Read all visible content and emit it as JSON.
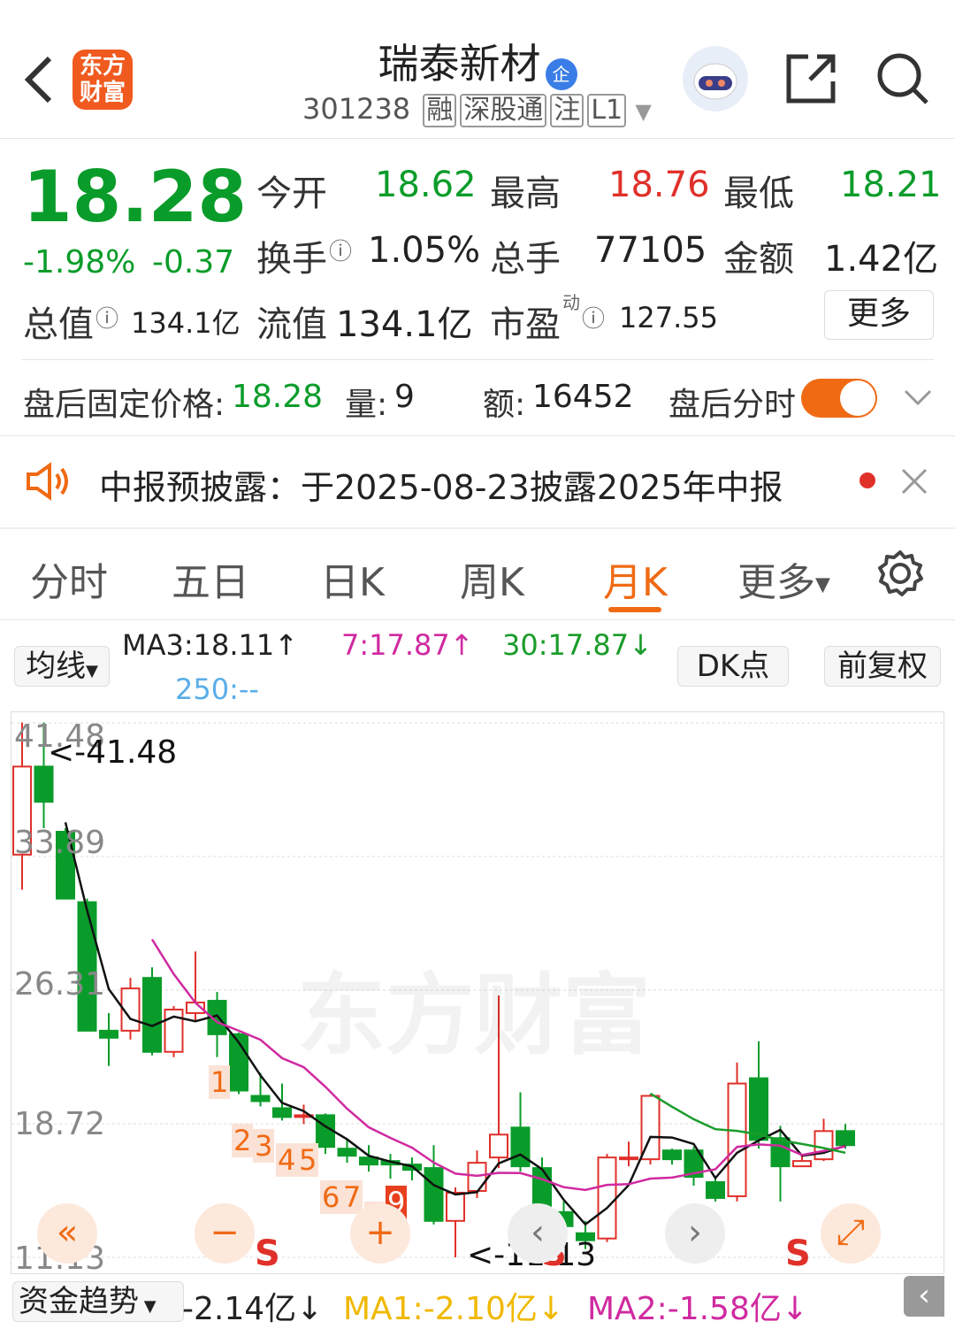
{
  "header": {
    "title": "瑞泰新材",
    "badge": "企",
    "logo_line1": "东方",
    "logo_line2": "财富",
    "code": "301238",
    "tags": [
      "融",
      "深股通",
      "注",
      "L1"
    ]
  },
  "quote": {
    "price": "18.28",
    "change_pct": "-1.98%",
    "change": "-0.37",
    "open_label": "今开",
    "open": "18.62",
    "high_label": "最高",
    "high": "18.76",
    "low_label": "最低",
    "low": "18.21",
    "turnover_label": "换手",
    "turnover": "1.05%",
    "volume_label": "总手",
    "volume": "77105",
    "amount_label": "金额",
    "amount": "1.42亿",
    "mktcap_label": "总值",
    "mktcap": "134.1亿",
    "float_label": "流值",
    "float": "134.1亿",
    "pe_label": "市盈",
    "pe_sup": "动",
    "pe": "127.55",
    "more_label": "更多"
  },
  "after_hours": {
    "price_label": "盘后固定价格:",
    "price": "18.28",
    "vol_label": "量:",
    "vol": "9",
    "amt_label": "额:",
    "amt": "16452",
    "toggle_label": "盘后分时"
  },
  "notice": {
    "text": "中报预披露：于2025-08-23披露2025年中报"
  },
  "tabs": [
    "分时",
    "五日",
    "日K",
    "周K",
    "月K",
    "更多"
  ],
  "active_tab": "月K",
  "ma_bar": {
    "avg_label": "均线",
    "ma3": "MA3:18.11↑",
    "ma7": "7:17.87↑",
    "ma30": "30:17.87↓",
    "ma250": "250:--",
    "dk_label": "DK点",
    "adj_label": "前复权"
  },
  "chart_data": {
    "type": "candlestick",
    "y_ticks": [
      "41.48",
      "33.89",
      "26.31",
      "18.72",
      "11.13"
    ],
    "ylim": [
      11.13,
      41.48
    ],
    "max_label": "<-41.48",
    "min_label": "<-11.13",
    "watermark": "东方财富",
    "signals": [
      "1",
      "2",
      "3",
      "4",
      "5",
      "6",
      "7",
      "8",
      "9",
      "S",
      "S",
      "S"
    ],
    "candles": [
      [
        34,
        39,
        32,
        41.5
      ],
      [
        39,
        37,
        35.5,
        41.5
      ],
      [
        35.3,
        31.5,
        31.5,
        35.5
      ],
      [
        31.3,
        24,
        24,
        31.5
      ],
      [
        24,
        23.6,
        22,
        25
      ],
      [
        24,
        26.4,
        23.5,
        27
      ],
      [
        27,
        22.8,
        22.6,
        27.6
      ],
      [
        22.8,
        25.2,
        22.5,
        25.4
      ],
      [
        25,
        25.6,
        24.5,
        28.5
      ],
      [
        25.7,
        23.8,
        22.5,
        26.2
      ],
      [
        23.8,
        20.6,
        20.4,
        23.9
      ],
      [
        20.3,
        20,
        19.7,
        21.6
      ],
      [
        19.6,
        19.1,
        18.9,
        21
      ],
      [
        19.2,
        19.2,
        18.7,
        19.8
      ],
      [
        19.2,
        17.4,
        17,
        19.3
      ],
      [
        17.3,
        16.9,
        16.5,
        17.8
      ],
      [
        16.8,
        16.4,
        16,
        17.5
      ],
      [
        16.6,
        16.4,
        15.6,
        17
      ],
      [
        16.4,
        16.1,
        15.5,
        16.8
      ],
      [
        16.2,
        13.2,
        13,
        17.5
      ],
      [
        13.2,
        14.8,
        11.13,
        15.1
      ],
      [
        14.9,
        16.5,
        14.5,
        17.2
      ],
      [
        16.8,
        18.1,
        16.2,
        26
      ],
      [
        18.5,
        16.3,
        16,
        20.5
      ],
      [
        16.2,
        14,
        13.2,
        16.8
      ],
      [
        13.7,
        12.9,
        12.3,
        14.3
      ],
      [
        12.5,
        12.1,
        11.6,
        13.2
      ],
      [
        12.2,
        16.8,
        12,
        17
      ],
      [
        16.7,
        16.8,
        16.3,
        17.7
      ],
      [
        16.7,
        20.3,
        16.4,
        20.4
      ],
      [
        17.2,
        16.7,
        16.4,
        17.3
      ],
      [
        17.2,
        15.7,
        15.2,
        17.4
      ],
      [
        15.4,
        14.5,
        14.3,
        15.6
      ],
      [
        14.6,
        21,
        14.3,
        22.2
      ],
      [
        21.3,
        17.8,
        17.3,
        23.4
      ],
      [
        17.9,
        16.3,
        14.3,
        18.6
      ],
      [
        16.3,
        16.6,
        16.5,
        16.9
      ],
      [
        16.7,
        18.3,
        16.6,
        19
      ],
      [
        18.3,
        17.5,
        17.3,
        18.7
      ]
    ]
  },
  "fund_bar": {
    "label": "资金趋势",
    "value": "-2.14亿↓",
    "ma1": "MA1:-2.10亿↓",
    "ma2": "MA2:-1.58亿↓"
  }
}
